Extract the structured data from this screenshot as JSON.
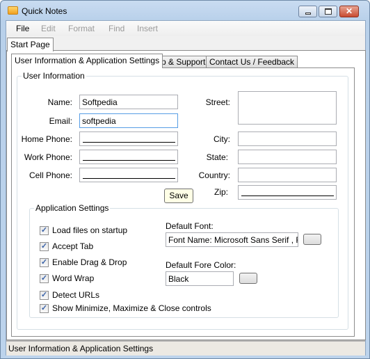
{
  "window": {
    "title": "Quick Notes",
    "icon": "folder-icon"
  },
  "menu": [
    "File",
    "Edit",
    "Format",
    "Find",
    "Insert"
  ],
  "tabs": {
    "main": "Start Page",
    "sub": [
      "User Information & Application Settings",
      "Help & Support",
      "Contact Us / Feedback"
    ]
  },
  "user_info": {
    "legend": "User Information",
    "name_label": "Name:",
    "name_value": "Softpedia",
    "email_label": "Email:",
    "email_value": "softpedia",
    "home_label": "Home Phone:",
    "work_label": "Work Phone:",
    "cell_label": "Cell Phone:",
    "street_label": "Street:",
    "city_label": "City:",
    "state_label": "State:",
    "country_label": "Country:",
    "zip_label": "Zip:",
    "save": "Save"
  },
  "app_settings": {
    "legend": "Application Settings",
    "checkboxes": [
      {
        "label": "Load files on startup",
        "checked": true
      },
      {
        "label": "Accept Tab",
        "checked": true
      },
      {
        "label": "Enable Drag & Drop",
        "checked": true
      },
      {
        "label": "Word Wrap",
        "checked": true
      },
      {
        "label": "Detect URLs",
        "checked": true
      },
      {
        "label": "Show Minimize, Maximize & Close controls",
        "checked": true
      }
    ],
    "font_label": "Default Font:",
    "font_value": "Font Name: Microsoft Sans Serif  , Font",
    "color_label": "Default Fore Color:",
    "color_value": "Black"
  },
  "status": "User Information & Application Settings"
}
